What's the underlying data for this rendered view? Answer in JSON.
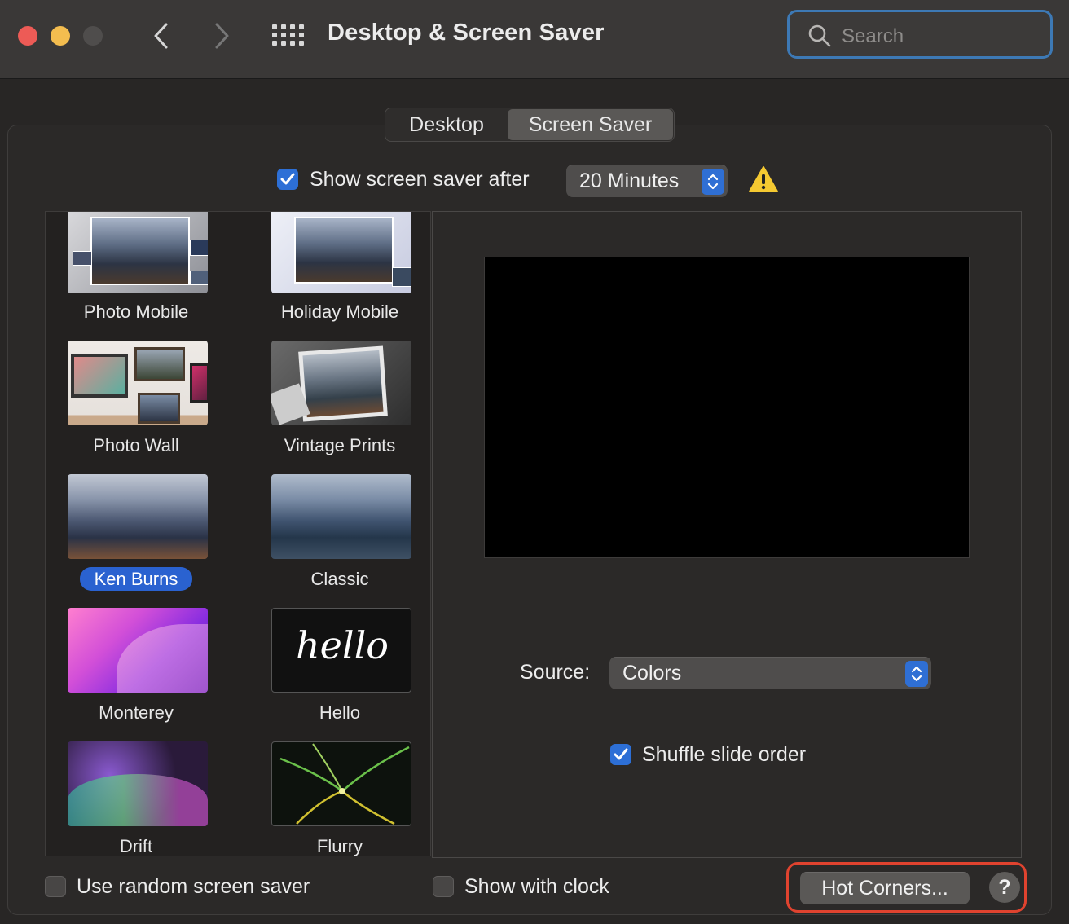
{
  "window": {
    "title": "Desktop & Screen Saver",
    "traffic_lights": {
      "close_color": "#ed5b56",
      "minimize_color": "#f3bd4f",
      "zoom_color": "#4f4d4c"
    }
  },
  "toolbar": {
    "back_icon": "chevron-left-icon",
    "forward_icon": "chevron-right-icon",
    "show_all_icon": "grid-icon",
    "search": {
      "placeholder": "Search"
    }
  },
  "tabs": [
    {
      "label": "Desktop",
      "selected": false
    },
    {
      "label": "Screen Saver",
      "selected": true
    }
  ],
  "show_after": {
    "label": "Show screen saver after",
    "checked": true,
    "value": "20 Minutes",
    "warning_icon": "warning-icon",
    "warning_color": "#f5c931"
  },
  "screen_savers": [
    {
      "name": "Photo Mobile",
      "selected": false
    },
    {
      "name": "Holiday Mobile",
      "selected": false
    },
    {
      "name": "Photo Wall",
      "selected": false
    },
    {
      "name": "Vintage Prints",
      "selected": false
    },
    {
      "name": "Ken Burns",
      "selected": true
    },
    {
      "name": "Classic",
      "selected": false
    },
    {
      "name": "Monterey",
      "selected": false
    },
    {
      "name": "Hello",
      "selected": false
    },
    {
      "name": "Drift",
      "selected": false
    },
    {
      "name": "Flurry",
      "selected": false
    }
  ],
  "hello_text": "hello",
  "source": {
    "label": "Source:",
    "value": "Colors"
  },
  "shuffle": {
    "label": "Shuffle slide order",
    "checked": true
  },
  "random": {
    "label": "Use random screen saver",
    "checked": false
  },
  "clock": {
    "label": "Show with clock",
    "checked": false
  },
  "hot_corners": {
    "label": "Hot Corners..."
  },
  "help": {
    "label": "?"
  },
  "accent_color": "#2d6fd6",
  "highlight_color": "#e0432f"
}
